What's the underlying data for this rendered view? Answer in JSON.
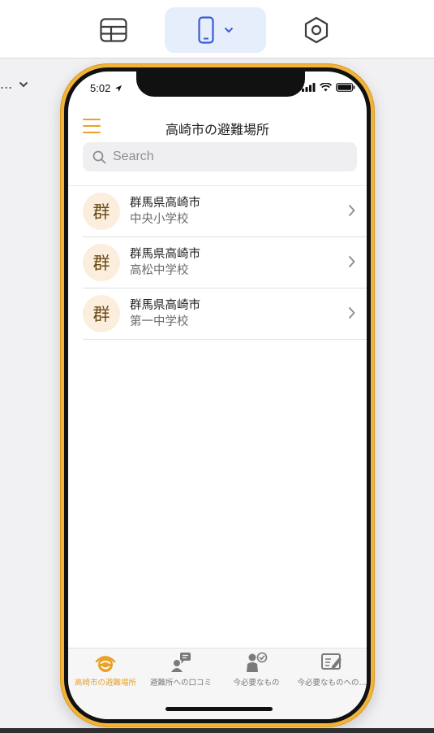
{
  "toolbar": {
    "table_icon": "table-icon",
    "device_icon": "phone-icon",
    "device_dropdown_icon": "chevron-down-icon",
    "settings_icon": "hexagon-settings-icon"
  },
  "left_panel": {
    "crumb_text": "...",
    "crumb_icon": "chevron-down-icon"
  },
  "phone": {
    "status": {
      "time": "5:02"
    },
    "header": {
      "title": "高崎市の避難場所",
      "menu_icon": "hamburger-menu-icon"
    },
    "search": {
      "placeholder": "Search",
      "value": ""
    },
    "list": [
      {
        "avatar": "群",
        "title": "群馬県高崎市",
        "subtitle": "中央小学校"
      },
      {
        "avatar": "群",
        "title": "群馬県高崎市",
        "subtitle": "高松中学校"
      },
      {
        "avatar": "群",
        "title": "群馬県高崎市",
        "subtitle": "第一中学校"
      }
    ],
    "tabs": [
      {
        "label": "高崎市の避難場所",
        "icon": "shelter-icon",
        "active": true
      },
      {
        "label": "避難所への口コミ",
        "icon": "chat-person-icon",
        "active": false
      },
      {
        "label": "今必要なもの",
        "icon": "person-check-icon",
        "active": false
      },
      {
        "label": "今必要なものへの...",
        "icon": "board-edit-icon",
        "active": false
      }
    ]
  },
  "colors": {
    "accent": "#e9a227",
    "frame": "#f2b33a",
    "device_button_bg": "#e6eefb",
    "avatar_bg": "#fbeedd"
  }
}
